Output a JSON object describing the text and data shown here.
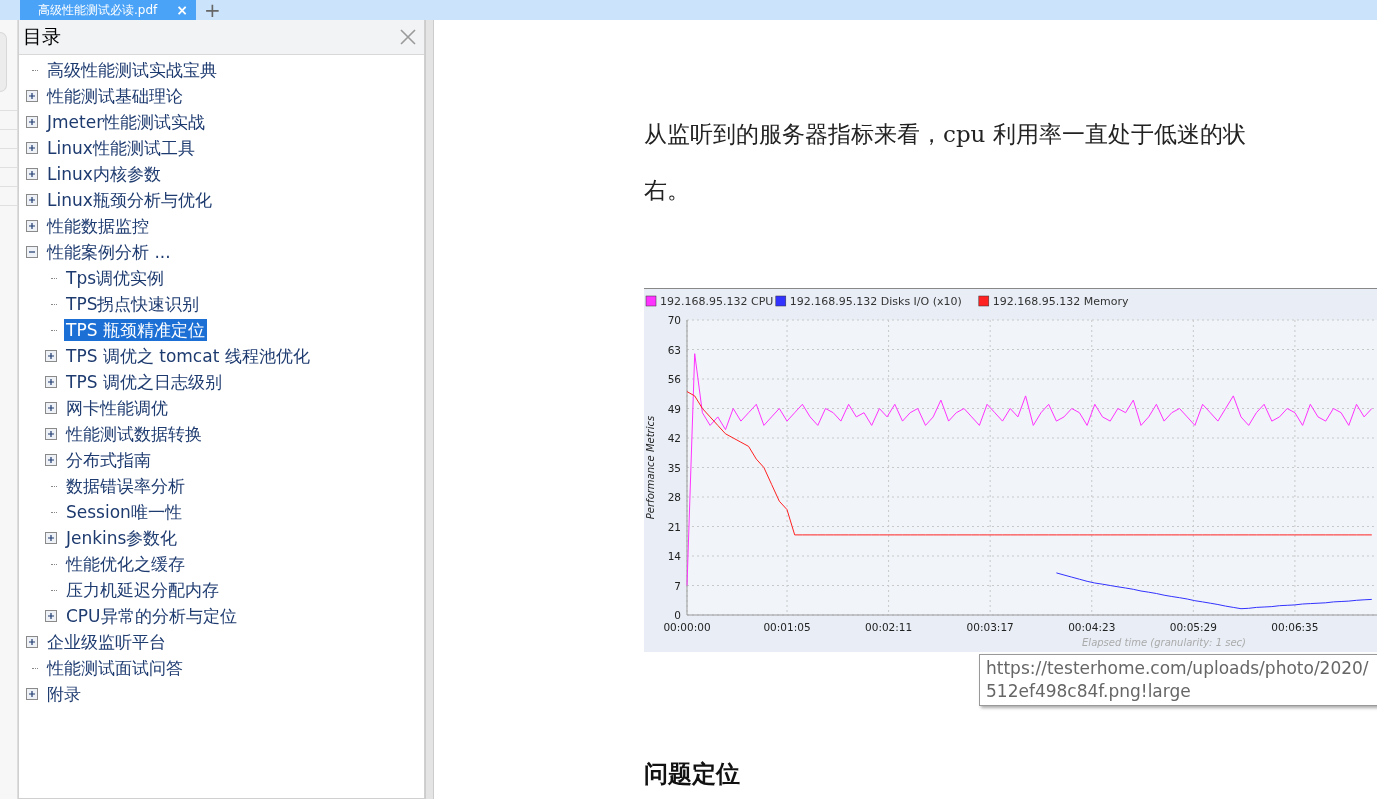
{
  "tab_bar": {
    "tabs": [
      {
        "label": "高级性能测试必读.pdf",
        "selected": true,
        "close": "×"
      }
    ],
    "new_tab": "+"
  },
  "outline": {
    "title": "目录",
    "items": [
      {
        "label": "高级性能测试实战宝典",
        "kind": "leaf",
        "selected": false
      },
      {
        "label": "性能测试基础理论",
        "kind": "branch",
        "expanded": false,
        "selected": false
      },
      {
        "label": "Jmeter性能测试实战",
        "kind": "branch",
        "expanded": false,
        "selected": false
      },
      {
        "label": "Linux性能测试工具",
        "kind": "branch",
        "expanded": false,
        "selected": false
      },
      {
        "label": "Linux内核参数",
        "kind": "branch",
        "expanded": false,
        "selected": false
      },
      {
        "label": "Linux瓶颈分析与优化",
        "kind": "branch",
        "expanded": false,
        "selected": false
      },
      {
        "label": "性能数据监控",
        "kind": "branch",
        "expanded": false,
        "selected": false
      },
      {
        "label": "性能案例分析 ...",
        "kind": "branch",
        "expanded": true,
        "selected": false,
        "children": [
          {
            "label": "Tps调优实例",
            "kind": "leaf",
            "selected": false
          },
          {
            "label": "TPS拐点快速识别",
            "kind": "leaf",
            "selected": false
          },
          {
            "label": "TPS 瓶颈精准定位",
            "kind": "leaf",
            "selected": true
          },
          {
            "label": "TPS 调优之 tomcat 线程池优化",
            "kind": "branch",
            "expanded": false,
            "selected": false
          },
          {
            "label": "TPS 调优之日志级别",
            "kind": "branch",
            "expanded": false,
            "selected": false
          },
          {
            "label": "网卡性能调优",
            "kind": "branch",
            "expanded": false,
            "selected": false
          },
          {
            "label": "性能测试数据转换",
            "kind": "branch",
            "expanded": false,
            "selected": false
          },
          {
            "label": "分布式指南",
            "kind": "branch",
            "expanded": false,
            "selected": false
          },
          {
            "label": "数据错误率分析",
            "kind": "leaf",
            "selected": false
          },
          {
            "label": "Session唯一性",
            "kind": "leaf",
            "selected": false
          },
          {
            "label": "Jenkins参数化",
            "kind": "branch",
            "expanded": false,
            "selected": false
          },
          {
            "label": "性能优化之缓存",
            "kind": "leaf",
            "selected": false
          },
          {
            "label": "压力机延迟分配内存",
            "kind": "leaf",
            "selected": false
          },
          {
            "label": "CPU异常的分析与定位",
            "kind": "branch",
            "expanded": false,
            "selected": false
          }
        ]
      },
      {
        "label": "企业级监听平台",
        "kind": "branch",
        "expanded": false,
        "selected": false
      },
      {
        "label": "性能测试面试问答",
        "kind": "leaf",
        "selected": false
      },
      {
        "label": "附录",
        "kind": "branch",
        "expanded": false,
        "selected": false
      }
    ]
  },
  "document": {
    "paragraph": [
      "从监听到的服务器指标来看，cpu 利用率一直处于低迷的状",
      "右。"
    ],
    "chart": {
      "chart_data": {
        "type": "line",
        "grid": true,
        "legend": "top",
        "xlabel": "Elapsed time (granularity: 1 sec)",
        "ylabel": "Performance Metrics",
        "xlim": [
          0,
          449
        ],
        "ylim": [
          0,
          70
        ],
        "xticks": [
          {
            "value": 0,
            "label": "00:00:00"
          },
          {
            "value": 65,
            "label": "00:01:05"
          },
          {
            "value": 131,
            "label": "00:02:11"
          },
          {
            "value": 197,
            "label": "00:03:17"
          },
          {
            "value": 263,
            "label": "00:04:23"
          },
          {
            "value": 329,
            "label": "00:05:29"
          },
          {
            "value": 395,
            "label": "00:06:35"
          }
        ],
        "yticks": [
          0,
          7,
          14,
          21,
          28,
          35,
          42,
          49,
          56,
          63,
          70
        ],
        "x": [
          0,
          5,
          10,
          15,
          20,
          25,
          30,
          35,
          40,
          45,
          50,
          55,
          60,
          65,
          70,
          75,
          80,
          85,
          90,
          95,
          100,
          105,
          110,
          115,
          120,
          125,
          130,
          135,
          140,
          145,
          150,
          155,
          160,
          165,
          170,
          175,
          180,
          185,
          190,
          195,
          200,
          205,
          210,
          215,
          220,
          225,
          230,
          235,
          240,
          245,
          250,
          255,
          260,
          265,
          270,
          275,
          280,
          285,
          290,
          295,
          300,
          305,
          310,
          315,
          320,
          325,
          330,
          335,
          340,
          345,
          350,
          355,
          360,
          365,
          370,
          375,
          380,
          385,
          390,
          395,
          400,
          405,
          410,
          415,
          420,
          425,
          430,
          435,
          440,
          445
        ],
        "series": [
          {
            "name": "192.168.95.132 CPU",
            "color": "#ff33ff",
            "values": [
              7,
              62,
              48,
              45,
              47,
              44,
              49,
              46,
              48,
              50,
              45,
              47,
              49,
              46,
              48,
              50,
              47,
              45,
              49,
              48,
              46,
              50,
              47,
              48,
              45,
              49,
              47,
              50,
              46,
              48,
              49,
              45,
              47,
              51,
              46,
              48,
              49,
              47,
              45,
              50,
              48,
              46,
              49,
              47,
              52,
              45,
              48,
              50,
              46,
              47,
              49,
              48,
              45,
              50,
              47,
              46,
              49,
              48,
              51,
              45,
              47,
              50,
              46,
              48,
              49,
              47,
              45,
              50,
              48,
              46,
              49,
              52,
              47,
              45,
              48,
              50,
              46,
              47,
              49,
              48,
              45,
              50,
              47,
              46,
              49,
              48,
              45,
              50,
              47,
              49
            ]
          },
          {
            "name": "192.168.95.132 Disks I/O (x10)",
            "color": "#3333ff",
            "values": [
              null,
              null,
              null,
              null,
              null,
              null,
              null,
              null,
              null,
              null,
              null,
              null,
              null,
              null,
              null,
              null,
              null,
              null,
              null,
              null,
              null,
              null,
              null,
              null,
              null,
              null,
              null,
              null,
              null,
              null,
              null,
              null,
              null,
              null,
              null,
              null,
              null,
              null,
              null,
              null,
              null,
              null,
              null,
              null,
              null,
              null,
              null,
              null,
              10,
              9.5,
              9,
              8.5,
              8,
              7.6,
              7.3,
              7.0,
              6.7,
              6.4,
              6.1,
              5.7,
              5.4,
              5.1,
              4.7,
              4.4,
              4.1,
              3.8,
              3.4,
              3.1,
              2.8,
              2.5,
              2.1,
              1.8,
              1.5,
              1.6,
              1.8,
              1.9,
              2.0,
              2.2,
              2.3,
              2.4,
              2.6,
              2.7,
              2.8,
              2.9,
              3.1,
              3.2,
              3.3,
              3.5,
              3.6,
              3.7
            ]
          },
          {
            "name": "192.168.95.132 Memory",
            "color": "#ff2222",
            "values": [
              53,
              52,
              49,
              47,
              45,
              43,
              42,
              41,
              40,
              37,
              35,
              31,
              27,
              25,
              19,
              19,
              19,
              19,
              19,
              19,
              19,
              19,
              19,
              19,
              19,
              19,
              19,
              19,
              19,
              19,
              19,
              19,
              19,
              19,
              19,
              19,
              19,
              19,
              19,
              19,
              19,
              19,
              19,
              19,
              19,
              19,
              19,
              19,
              19,
              19,
              19,
              19,
              19,
              19,
              19,
              19,
              19,
              19,
              19,
              19,
              19,
              19,
              19,
              19,
              19,
              19,
              19,
              19,
              19,
              19,
              19,
              19,
              19,
              19,
              19,
              19,
              19,
              19,
              19,
              19,
              19,
              19,
              19,
              19,
              19,
              19,
              19,
              19,
              19,
              19
            ]
          }
        ]
      }
    },
    "tooltip": [
      "https://testerhome.com/uploads/photo/2020/",
      "512ef498c84f.png!large"
    ],
    "heading": "问题定位"
  }
}
